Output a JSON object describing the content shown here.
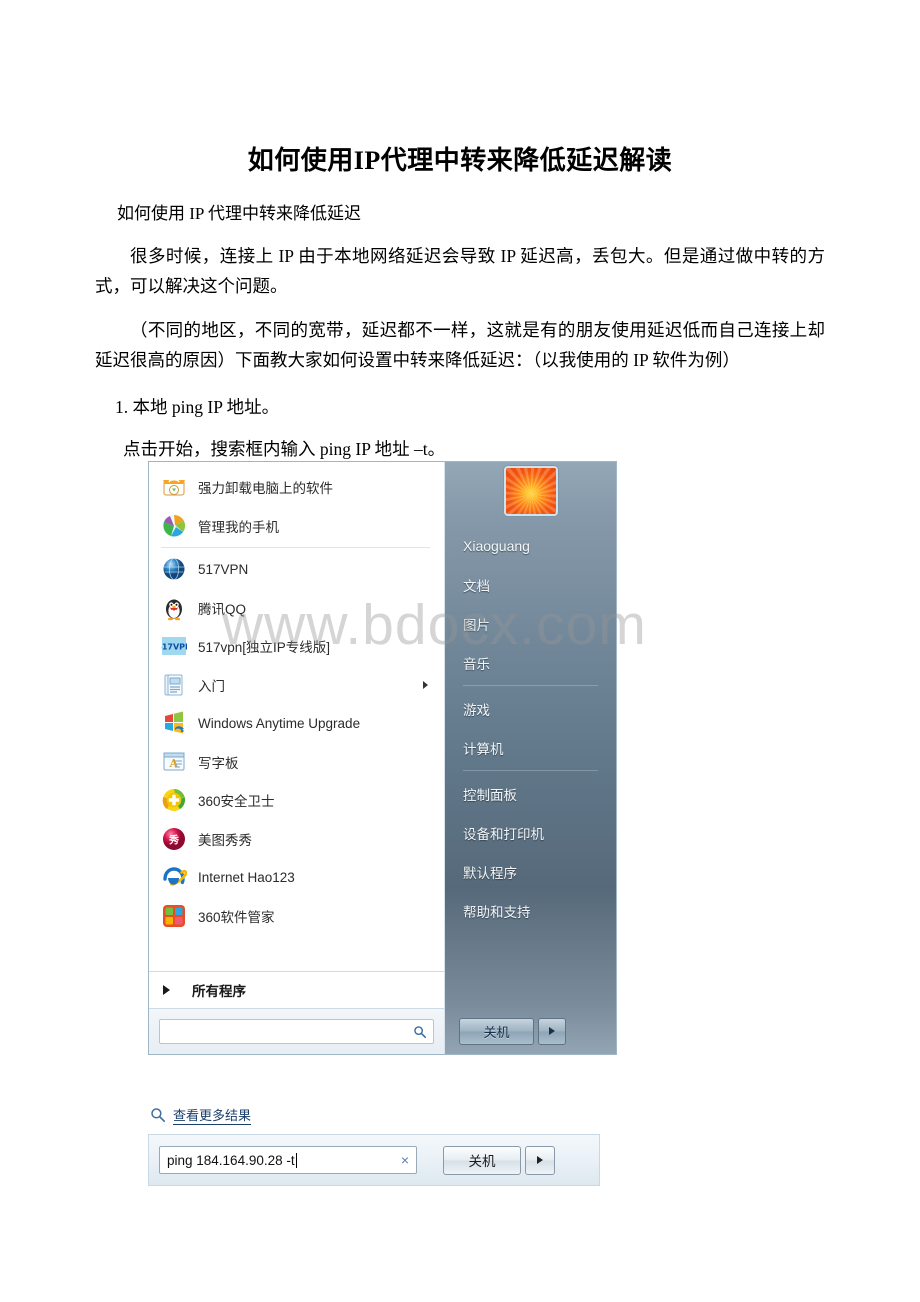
{
  "document": {
    "title": "如何使用IP代理中转来降低延迟解读",
    "subtitle": "如何使用 IP 代理中转来降低延迟",
    "paragraph1": "很多时候，连接上 IP 由于本地网络延迟会导致 IP 延迟高，丢包大。但是通过做中转的方式，可以解决这个问题。",
    "paragraph2": "（不同的地区，不同的宽带，延迟都不一样，这就是有的朋友使用延迟低而自己连接上却延迟很高的原因）下面教大家如何设置中转来降低延迟：（以我使用的 IP 软件为例）",
    "step1": "1. 本地 ping  IP 地址。",
    "step1_detail": "点击开始，搜索框内输入 ping IP 地址 –t。",
    "watermark": "www.bdocx.com"
  },
  "start_menu": {
    "programs": [
      {
        "label": "强力卸载电脑上的软件",
        "icon": "uninstall-icon",
        "has_submenu": false
      },
      {
        "label": "管理我的手机",
        "icon": "phone-manager-icon",
        "has_submenu": false
      },
      {
        "label": "517VPN",
        "icon": "globe-icon",
        "has_submenu": false
      },
      {
        "label": "腾讯QQ",
        "icon": "qq-penguin-icon",
        "has_submenu": false
      },
      {
        "label": "517vpn[独立IP专线版]",
        "icon": "517vpn-icon",
        "has_submenu": false
      },
      {
        "label": "入门",
        "icon": "getting-started-icon",
        "has_submenu": true
      },
      {
        "label": "Windows Anytime Upgrade",
        "icon": "windows-flag-icon",
        "has_submenu": false
      },
      {
        "label": "写字板",
        "icon": "wordpad-icon",
        "has_submenu": false
      },
      {
        "label": "360安全卫士",
        "icon": "360-safe-icon",
        "has_submenu": false
      },
      {
        "label": "美图秀秀",
        "icon": "meitu-icon",
        "has_submenu": false
      },
      {
        "label": "Internet  Hao123",
        "icon": "internet-explorer-icon",
        "has_submenu": false
      },
      {
        "label": "360软件管家",
        "icon": "360-software-manager-icon",
        "has_submenu": false
      }
    ],
    "separator_after_index": 1,
    "all_programs_label": "所有程序",
    "search": {
      "value": "",
      "placeholder": ""
    },
    "right_panel": {
      "user_name": "Xiaoguang",
      "avatar_icon": "sunflower-avatar",
      "items": [
        {
          "label": "文档"
        },
        {
          "label": "图片"
        },
        {
          "label": "音乐"
        },
        {
          "label": "游戏"
        },
        {
          "label": "计算机"
        },
        {
          "label": "控制面板"
        },
        {
          "label": "设备和打印机"
        },
        {
          "label": "默认程序"
        },
        {
          "label": "帮助和支持"
        }
      ],
      "shutdown_label": "关机"
    }
  },
  "search_result_strip": {
    "see_more_label": "查看更多结果",
    "query_value": "ping 184.164.90.28 -t",
    "clear_glyph": "×",
    "shutdown_label": "关机"
  },
  "colors": {
    "start_panel_right": "#647c8e",
    "link_blue": "#1a3f6b",
    "watermark_gray": "#969696"
  }
}
